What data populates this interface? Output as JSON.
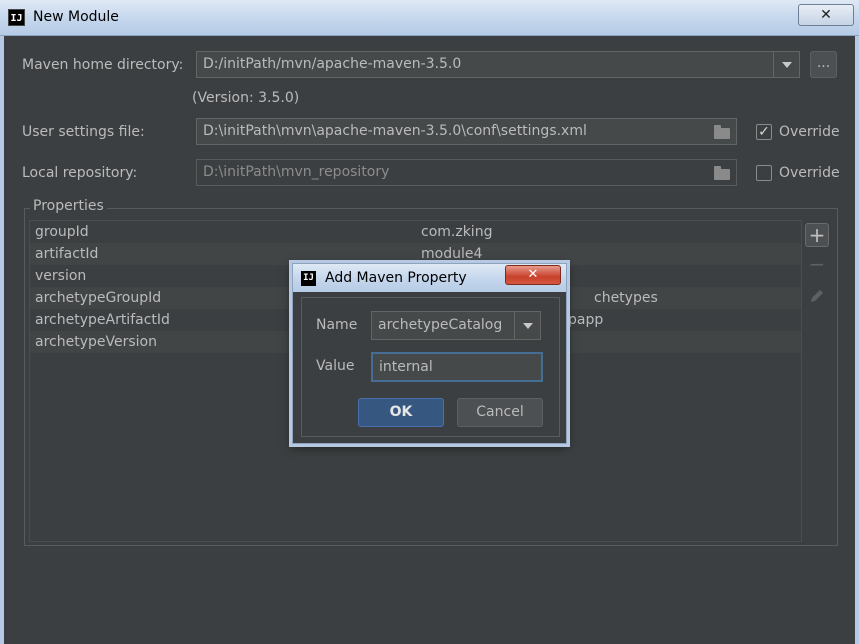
{
  "window": {
    "title": "New Module",
    "close_label": "✕"
  },
  "maven_home": {
    "label": "Maven home directory:",
    "value": "D:/initPath/mvn/apache-maven-3.5.0",
    "version": "(Version: 3.5.0)",
    "browse_label": "..."
  },
  "user_settings": {
    "label": "User settings file:",
    "value": "D:\\initPath\\mvn\\apache-maven-3.5.0\\conf\\settings.xml",
    "override_label": "Override",
    "override_checked": true
  },
  "local_repo": {
    "label": "Local repository:",
    "value": "D:\\initPath\\mvn_repository",
    "override_label": "Override",
    "override_checked": false
  },
  "properties": {
    "title": "Properties",
    "rows": [
      {
        "key": "groupId",
        "value": "com.zking"
      },
      {
        "key": "artifactId",
        "value": "module4"
      },
      {
        "key": "version",
        "value": ""
      },
      {
        "key": "archetypeGroupId",
        "value": "chetypes"
      },
      {
        "key": "archetypeArtifactId",
        "value": "papp"
      },
      {
        "key": "archetypeVersion",
        "value": ""
      }
    ],
    "add_label": "+",
    "remove_label": "−"
  },
  "dialog": {
    "title": "Add Maven Property",
    "close_label": "✕",
    "name_label": "Name",
    "name_value": "archetypeCatalog",
    "value_label": "Value",
    "value_value": "internal",
    "ok_label": "OK",
    "cancel_label": "Cancel"
  }
}
